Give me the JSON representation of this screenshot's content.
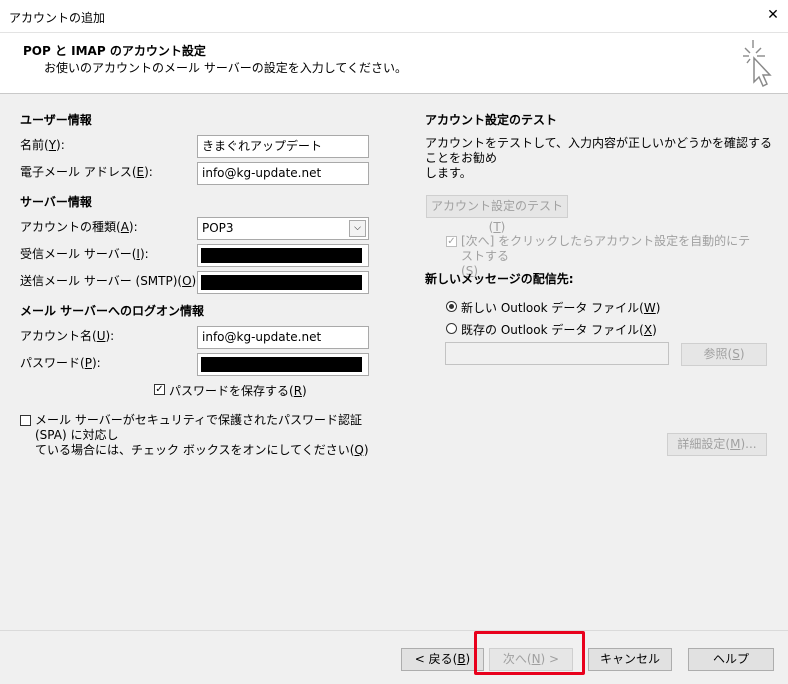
{
  "window": {
    "title": "アカウントの追加",
    "close_symbol": "✕"
  },
  "header": {
    "title": "POP と IMAP のアカウント設定",
    "subtitle": "お使いのアカウントのメール サーバーの設定を入力してください。",
    "icon": "wizard-cursor-icon"
  },
  "user_info": {
    "section": "ユーザー情報",
    "name_label": "名前(",
    "name_key": "Y",
    "name_label_end": "):",
    "name_value": "きまぐれアップデート",
    "email_label": "電子メール アドレス(",
    "email_key": "E",
    "email_label_end": "):",
    "email_value": "info@kg-update.net"
  },
  "server_info": {
    "section": "サーバー情報",
    "type_label": "アカウントの種類(",
    "type_key": "A",
    "type_label_end": "):",
    "type_value": "POP3",
    "incoming_label": "受信メール サーバー(",
    "incoming_key": "I",
    "incoming_label_end": "):",
    "outgoing_label": "送信メール サーバー (SMTP)(",
    "outgoing_key": "O",
    "outgoing_label_end": "):"
  },
  "logon_info": {
    "section": "メール サーバーへのログオン情報",
    "account_label": "アカウント名(",
    "account_key": "U",
    "account_label_end": "):",
    "account_value": "info@kg-update.net",
    "password_label": "パスワード(",
    "password_key": "P",
    "password_label_end": "):",
    "save_password": "パスワードを保存する(",
    "save_password_key": "R",
    "save_password_end": ")",
    "save_password_checked": true,
    "spa_line1": "メール サーバーがセキュリティで保護されたパスワード認証 (SPA) に対応し",
    "spa_line2": "ている場合には、チェック ボックスをオンにしてください(",
    "spa_key": "Q",
    "spa_end": ")",
    "spa_checked": false
  },
  "test": {
    "section": "アカウント設定のテスト",
    "desc_line1": "アカウントをテストして、入力内容が正しいかどうかを確認することをお勧め",
    "desc_line2": "します。",
    "button": "アカウント設定のテスト(",
    "button_key": "T",
    "button_end": ")",
    "auto_line1": "[次へ] をクリックしたらアカウント設定を自動的にテストする",
    "auto_line2_open": "(",
    "auto_key": "S",
    "auto_line2_close": ")",
    "auto_checked": true
  },
  "delivery": {
    "section": "新しいメッセージの配信先:",
    "new_file": "新しい Outlook データ ファイル(",
    "new_file_key": "W",
    "new_file_end": ")",
    "existing_file": "既存の Outlook データ ファイル(",
    "existing_file_key": "X",
    "existing_file_end": ")",
    "browse": "参照(",
    "browse_key": "S",
    "browse_end": ")",
    "selected": "new"
  },
  "advanced_button": "詳細設定(",
  "advanced_key": "M",
  "advanced_end": ")...",
  "footer": {
    "back": "< 戻る(",
    "back_key": "B",
    "back_end": ")",
    "next": "次へ(",
    "next_key": "N",
    "next_end": ") >",
    "cancel": "キャンセル",
    "help": "ヘルプ"
  },
  "colors": {
    "highlight": "#e8001c",
    "disabled_text": "#a0a0a0"
  }
}
